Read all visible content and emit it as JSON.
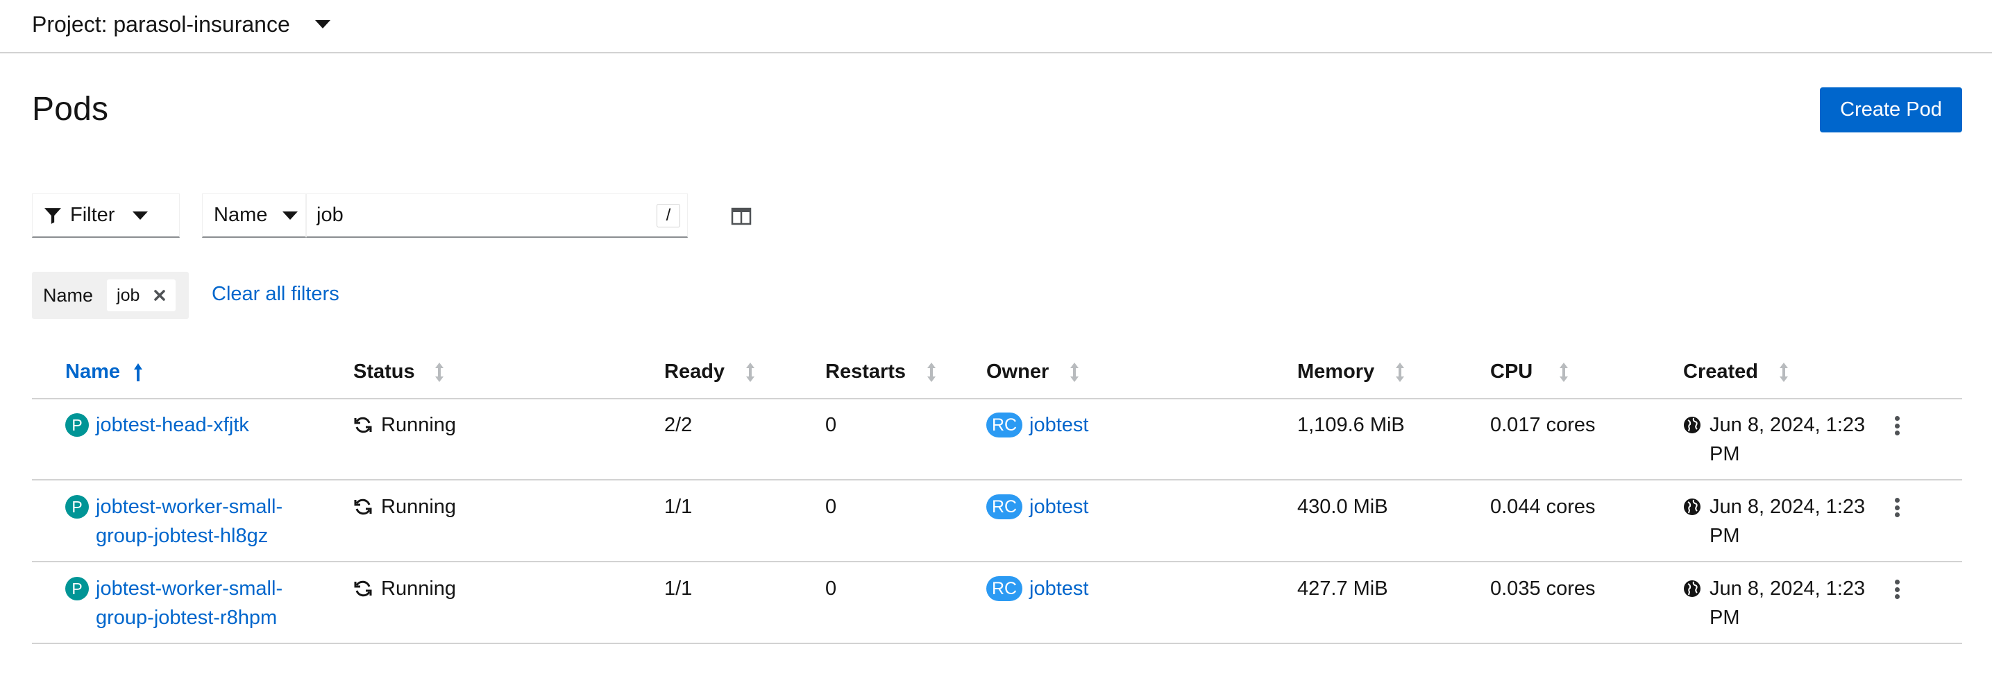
{
  "project": {
    "label": "Project: parasol-insurance"
  },
  "page": {
    "title": "Pods",
    "create_button": "Create Pod"
  },
  "toolbar": {
    "filter_label": "Filter",
    "name_select": "Name",
    "search_value": "job",
    "shortcut_key": "/"
  },
  "chips": {
    "category": "Name",
    "value": "job",
    "clear_all": "Clear all filters"
  },
  "table": {
    "columns": [
      "Name",
      "Status",
      "Ready",
      "Restarts",
      "Owner",
      "Memory",
      "CPU",
      "Created"
    ],
    "rows": [
      {
        "badge": "P",
        "name_line1": "jobtest-head-xfjtk",
        "name_line2": "",
        "status": "Running",
        "ready": "2/2",
        "restarts": "0",
        "owner_badge": "RC",
        "owner": "jobtest",
        "memory": "1,109.6 MiB",
        "cpu": "0.017 cores",
        "created": "Jun 8, 2024, 1:23 PM"
      },
      {
        "badge": "P",
        "name_line1": "jobtest-worker-small-",
        "name_line2": "group-jobtest-hl8gz",
        "status": "Running",
        "ready": "1/1",
        "restarts": "0",
        "owner_badge": "RC",
        "owner": "jobtest",
        "memory": "430.0 MiB",
        "cpu": "0.044 cores",
        "created": "Jun 8, 2024, 1:23 PM"
      },
      {
        "badge": "P",
        "name_line1": "jobtest-worker-small-",
        "name_line2": "group-jobtest-r8hpm",
        "status": "Running",
        "ready": "1/1",
        "restarts": "0",
        "owner_badge": "RC",
        "owner": "jobtest",
        "memory": "427.7 MiB",
        "cpu": "0.035 cores",
        "created": "Jun 8, 2024, 1:23 PM"
      }
    ]
  },
  "colors": {
    "primary_link": "#0066cc",
    "pod_badge": "#009596",
    "rc_badge": "#2b9af3",
    "border": "#d2d2d2"
  },
  "icons": {
    "project_caret": "caret-down-icon",
    "filter": "filter-icon",
    "columns": "columns-icon",
    "chip_close": "close-icon",
    "sort_active": "sort-up-icon",
    "sort_inactive": "sort-icon",
    "status": "sync-icon",
    "created": "globe-icon",
    "row_actions": "kebab-icon"
  }
}
